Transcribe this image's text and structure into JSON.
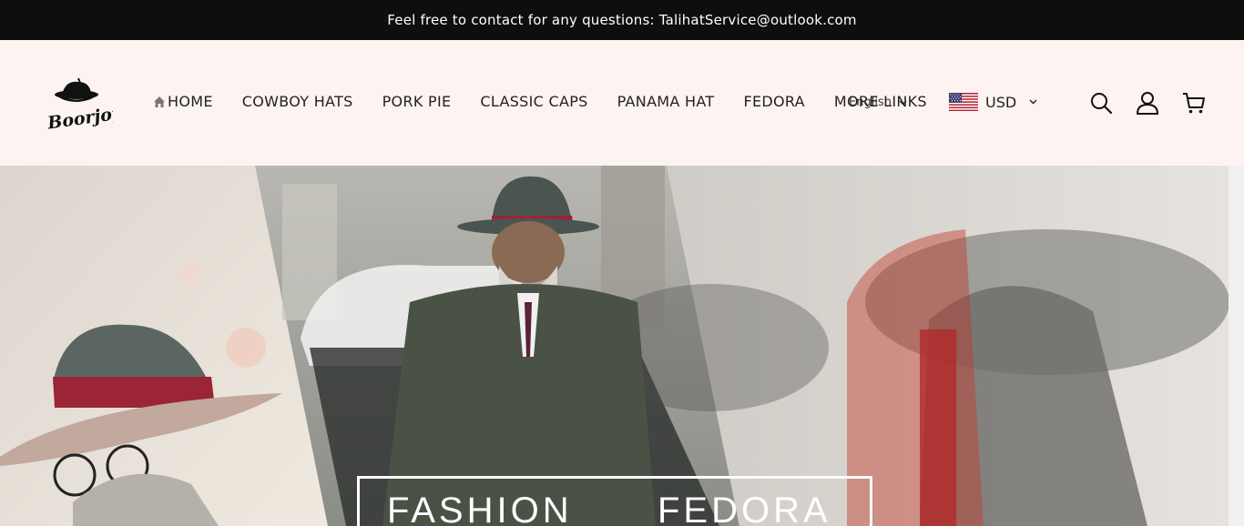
{
  "announcement": {
    "text": "Feel free to contact for any questions: TalihatService@outlook.com"
  },
  "header": {
    "logo_text": "Boorjoy",
    "nav": [
      {
        "label": "HOME",
        "icon": "home-icon"
      },
      {
        "label": "COWBOY HATS"
      },
      {
        "label": "PORK PIE"
      },
      {
        "label": "CLASSIC CAPS"
      },
      {
        "label": "PANAMA HAT"
      },
      {
        "label": "FEDORA"
      },
      {
        "label": "MORE LINKS"
      }
    ],
    "language": {
      "value": "English"
    },
    "currency": {
      "value": "USD",
      "flag_icon": "us-flag-icon"
    },
    "icons": [
      "search-icon",
      "account-icon",
      "cart-icon"
    ]
  },
  "hero": {
    "word1": "FASHION",
    "word2": "FEDORA"
  },
  "colors": {
    "announcement_bg": "#0e0e0e",
    "header_bg": "#fdf4f1",
    "hat_band": "#9b2435",
    "hat_felt": "#5b6663"
  }
}
